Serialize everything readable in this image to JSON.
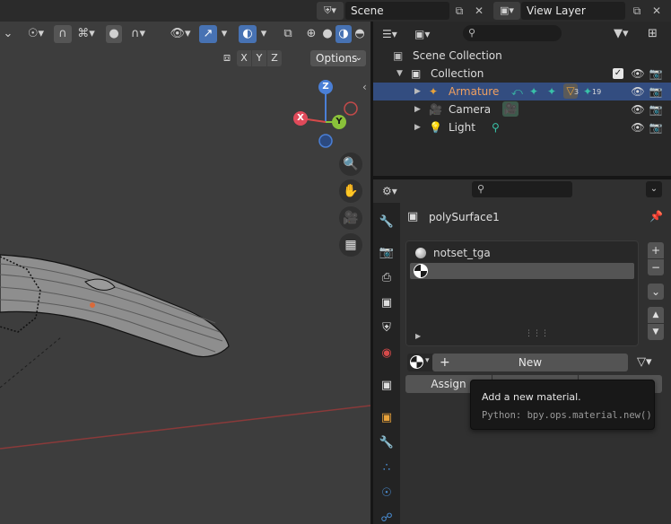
{
  "topbar": {
    "scene_label": "Scene",
    "view_layer_label": "View Layer"
  },
  "viewport": {
    "axis_buttons": [
      "X",
      "Y",
      "Z"
    ],
    "options_label": "Options",
    "gizmo": {
      "x": "X",
      "y": "Y",
      "z": "Z"
    }
  },
  "outliner": {
    "root_label": "Scene Collection",
    "collection_label": "Collection",
    "items": [
      {
        "label": "Armature",
        "badge_count": "3",
        "extra_count": "19",
        "selected": true
      },
      {
        "label": "Camera"
      },
      {
        "label": "Light"
      }
    ]
  },
  "properties": {
    "object_name": "polySurface1",
    "material_slots": [
      {
        "name": "notset_tga"
      },
      {
        "name": ""
      }
    ],
    "new_label": "New",
    "new_icon": "+",
    "assign_label": "Assign"
  },
  "tooltip": {
    "title": "Add a new material.",
    "python": "Python: bpy.ops.material.new()"
  },
  "colors": {
    "accent": "#4772b3",
    "selected_row": "#334d80",
    "armature_text": "#f0a060",
    "object_icon": "#e8a23a",
    "data_icon": "#39c2a8"
  }
}
